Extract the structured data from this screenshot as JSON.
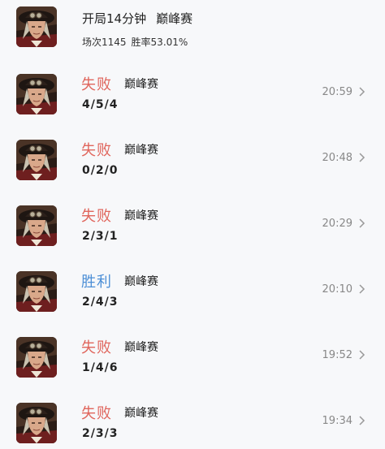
{
  "header": {
    "title": "开局14分钟",
    "mode": "巅峰赛",
    "games": "场次1145",
    "winrate": "胜率53.01%"
  },
  "icons": {
    "avatar": "hero-avatar-icon",
    "chevron": "chevron-right-icon"
  },
  "colors": {
    "lose": "#e0665d",
    "win": "#4d8fd6"
  },
  "matches": [
    {
      "result": "失败",
      "outcome": "lose",
      "mode": "巅峰赛",
      "kda": "4/5/4",
      "time": "20:59"
    },
    {
      "result": "失败",
      "outcome": "lose",
      "mode": "巅峰赛",
      "kda": "0/2/0",
      "time": "20:48"
    },
    {
      "result": "失败",
      "outcome": "lose",
      "mode": "巅峰赛",
      "kda": "2/3/1",
      "time": "20:29"
    },
    {
      "result": "胜利",
      "outcome": "win",
      "mode": "巅峰赛",
      "kda": "2/4/3",
      "time": "20:10"
    },
    {
      "result": "失败",
      "outcome": "lose",
      "mode": "巅峰赛",
      "kda": "1/4/6",
      "time": "19:52"
    },
    {
      "result": "失败",
      "outcome": "lose",
      "mode": "巅峰赛",
      "kda": "2/3/3",
      "time": "19:34"
    }
  ]
}
